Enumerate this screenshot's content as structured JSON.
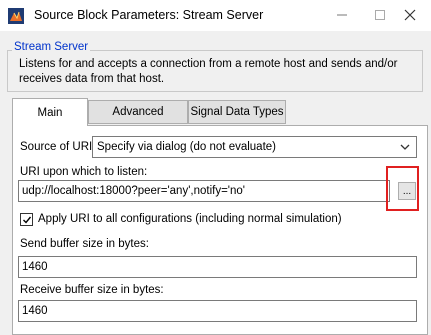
{
  "window": {
    "title": "Source Block Parameters: Stream Server",
    "icon": "simulink-block-icon",
    "controls": [
      "minimize-icon",
      "maximize-icon",
      "close-icon"
    ]
  },
  "block": {
    "group_label": "Stream Server",
    "description": "Listens for and accepts a connection from a remote host and sends and/or receives data from that host."
  },
  "tabs": [
    {
      "label": "Main",
      "active": true
    },
    {
      "label": "Advanced",
      "active": false
    },
    {
      "label": "Signal Data Types",
      "active": false
    }
  ],
  "main": {
    "source_of_uri": {
      "label": "Source of URI:",
      "value": "Specify via dialog (do not evaluate)"
    },
    "uri": {
      "label": "URI upon which to listen:",
      "value": "udp://localhost:18000?peer='any',notify='no'",
      "browse_label": "..."
    },
    "apply_uri": {
      "label": "Apply URI to all configurations (including normal simulation)",
      "checked": true
    },
    "send_buffer": {
      "label": "Send buffer size in bytes:",
      "value": "1460"
    },
    "receive_buffer": {
      "label": "Receive buffer size in bytes:",
      "value": "1460"
    }
  },
  "colors": {
    "group_label": "#0033cc",
    "highlight": "#e02020"
  }
}
